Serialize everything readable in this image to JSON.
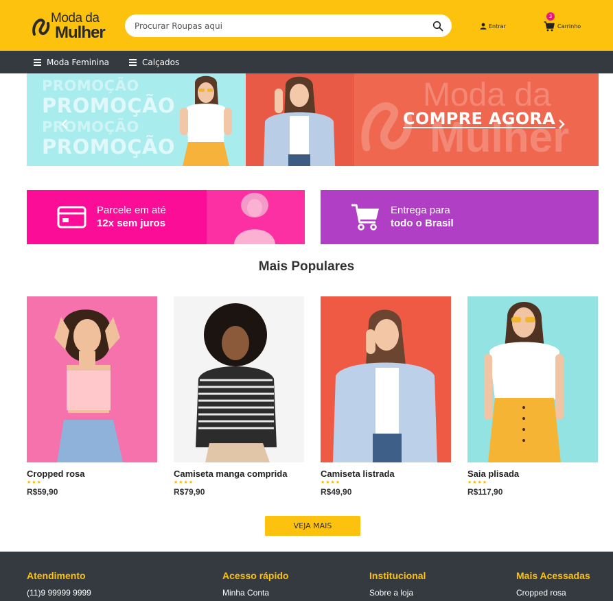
{
  "header": {
    "logo_top": "Moda da",
    "logo_bottom": "Mulher",
    "search_placeholder": "Procurar Roupas aqui",
    "login_label": "Entrar",
    "cart_label": "Carrinho",
    "cart_count": "3",
    "accent_color": "#fdc20d"
  },
  "nav": {
    "items": [
      {
        "label": "Moda Feminina",
        "icon": "menu-icon"
      },
      {
        "label": "Calçados",
        "icon": "menu-icon"
      }
    ]
  },
  "banner": {
    "promo_text": "PROMOÇÃO",
    "watermark_top": "Moda da",
    "watermark_bottom": "Mulher",
    "cta": "COMPRE AGORA"
  },
  "promo_cards": [
    {
      "line1": "Parcele em até",
      "line2": "12x sem juros",
      "icon": "credit-card-icon",
      "color": "#fb0d97"
    },
    {
      "line1": "Entrega para",
      "line2": "todo o Brasil",
      "icon": "shopping-cart-icon",
      "color": "#b13fc6"
    }
  ],
  "popular": {
    "title": "Mais Populares",
    "products": [
      {
        "name": "Cropped rosa",
        "rating": 3,
        "stars": "★★★",
        "price": "R$59,90"
      },
      {
        "name": "Camiseta manga comprida",
        "rating": 4,
        "stars": "★★★★",
        "price": "R$79,90"
      },
      {
        "name": "Camiseta listrada",
        "rating": 4,
        "stars": "★★★★",
        "price": "R$49,90"
      },
      {
        "name": "Saia plisada",
        "rating": 4,
        "stars": "★★★★",
        "price": "R$117,90"
      }
    ],
    "more_button": "VEJA MAIS"
  },
  "footer": {
    "columns": [
      {
        "heading": "Atendimento",
        "first_link": "(11)9 99999 9999"
      },
      {
        "heading": "Acesso rápido",
        "first_link": "Minha Conta"
      },
      {
        "heading": "Institucional",
        "first_link": "Sobre a loja"
      },
      {
        "heading": "Mais Acessadas",
        "first_link": "Cropped rosa"
      }
    ]
  }
}
